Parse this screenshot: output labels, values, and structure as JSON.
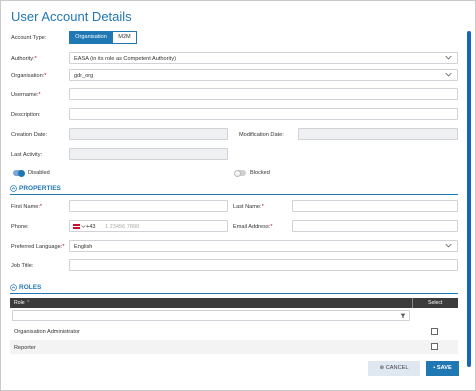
{
  "page": {
    "title": "User Account Details"
  },
  "account_type": {
    "label": "Account Type:",
    "options": [
      "Organisation",
      "M2M"
    ],
    "selected": "Organisation"
  },
  "authority": {
    "label": "Authority:",
    "value": "EASA (in its role as Competent Authority)"
  },
  "organisation": {
    "label": "Organisation:",
    "value": "gdr_org"
  },
  "username": {
    "label": "Username:",
    "value": ""
  },
  "description": {
    "label": "Description:",
    "value": ""
  },
  "creation_date": {
    "label": "Creation Date:",
    "value": ""
  },
  "modification_date": {
    "label": "Modification Date:",
    "value": ""
  },
  "last_activity": {
    "label": "Last Activity:",
    "value": ""
  },
  "status": {
    "disabled_label": "Disabled",
    "disabled_on": true,
    "blocked_label": "Blocked",
    "blocked_on": false
  },
  "properties": {
    "heading": "PROPERTIES",
    "first_name_label": "First Name:",
    "last_name_label": "Last Name:",
    "phone_label": "Phone:",
    "phone_code": "+43",
    "phone_placeholder": "1 23456 7890",
    "email_label": "Email Address:",
    "language_label": "Preferred Language:",
    "language_value": "English",
    "job_title_label": "Job Title:"
  },
  "roles": {
    "heading": "ROLES",
    "col_role": "Role",
    "col_select": "Select",
    "rows": [
      {
        "name": "Organisation Administrator",
        "selected": false
      },
      {
        "name": "Reporter",
        "selected": false
      }
    ]
  },
  "buttons": {
    "cancel": "CANCEL",
    "save": "SAVE"
  },
  "colors": {
    "accent": "#1f78b4",
    "required": "#d0021b",
    "table_header": "#3b3b3b"
  }
}
